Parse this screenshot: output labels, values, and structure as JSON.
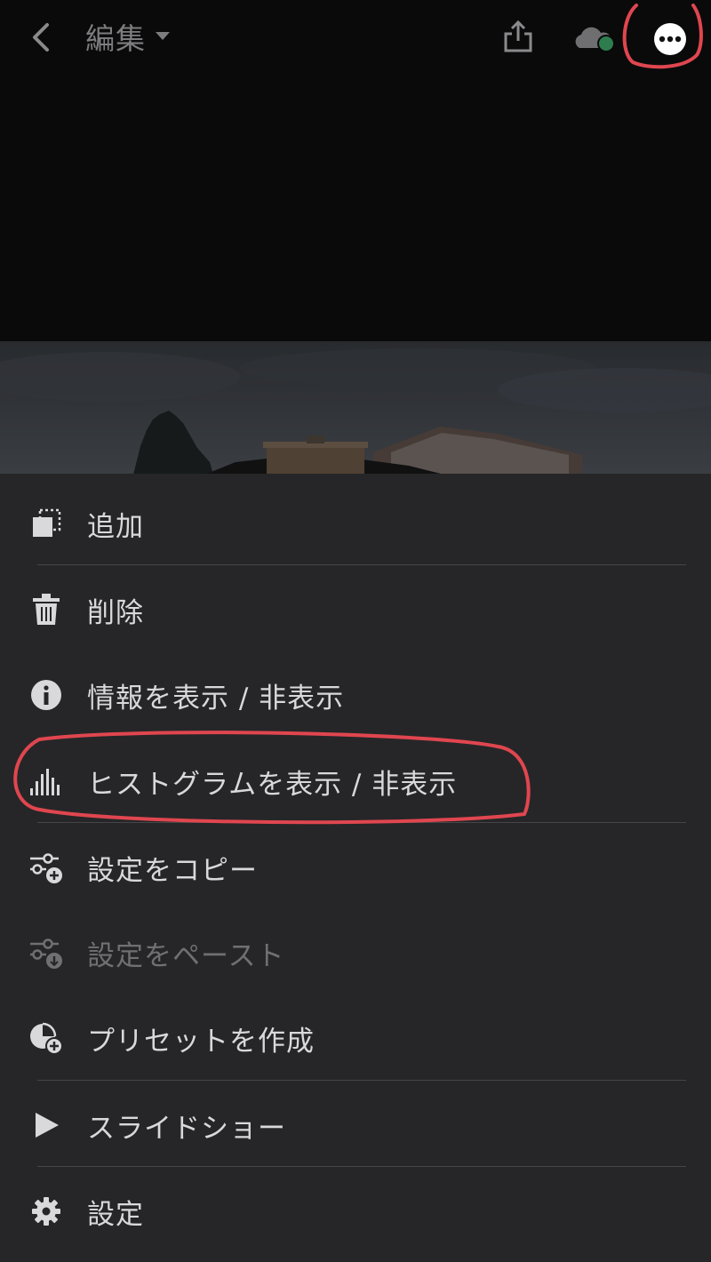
{
  "topbar": {
    "title": "編集"
  },
  "menu": {
    "items": [
      {
        "label": "追加",
        "icon": "add-to-album-icon",
        "enabled": true
      },
      {
        "label": "削除",
        "icon": "trash-icon",
        "enabled": true
      },
      {
        "label": "情報を表示 / 非表示",
        "icon": "info-icon",
        "enabled": true
      },
      {
        "label": "ヒストグラムを表示 / 非表示",
        "icon": "histogram-icon",
        "enabled": true
      },
      {
        "label": "設定をコピー",
        "icon": "copy-settings-icon",
        "enabled": true
      },
      {
        "label": "設定をペースト",
        "icon": "paste-settings-icon",
        "enabled": false
      },
      {
        "label": "プリセットを作成",
        "icon": "create-preset-icon",
        "enabled": true
      },
      {
        "label": "スライドショー",
        "icon": "play-icon",
        "enabled": true
      },
      {
        "label": "設定",
        "icon": "gear-icon",
        "enabled": true
      }
    ]
  },
  "colors": {
    "background": "#0a0a0b",
    "sheet": "#262628",
    "text": "#d9d9db",
    "disabled_text": "#707072",
    "sync_dot": "#2e7d4f",
    "annotation": "#e0464f"
  }
}
